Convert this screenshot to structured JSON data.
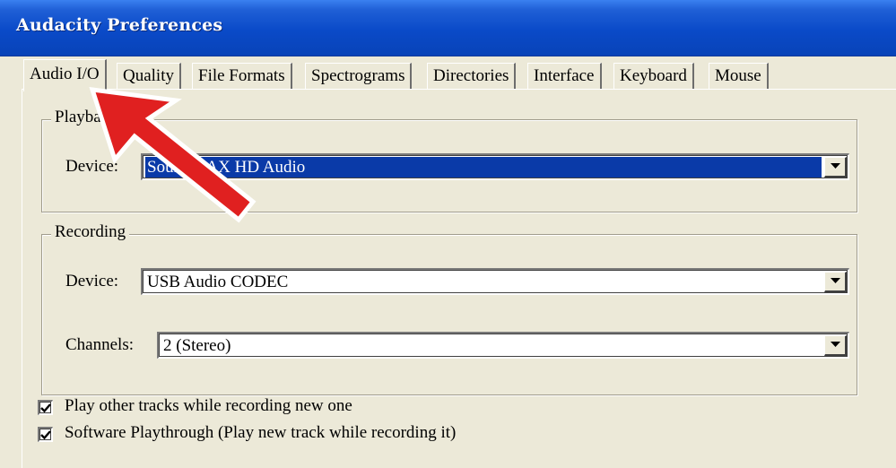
{
  "window": {
    "title": "Audacity Preferences"
  },
  "tabs": [
    {
      "label": "Audio I/O",
      "active": true
    },
    {
      "label": "Quality",
      "active": false
    },
    {
      "label": "File Formats",
      "active": false
    },
    {
      "label": "Spectrograms",
      "active": false
    },
    {
      "label": "Directories",
      "active": false
    },
    {
      "label": "Interface",
      "active": false
    },
    {
      "label": "Keyboard",
      "active": false
    },
    {
      "label": "Mouse",
      "active": false
    }
  ],
  "playback": {
    "group_label": "Playback",
    "device_label": "Device:",
    "device_value": "SoundMAX HD Audio"
  },
  "recording": {
    "group_label": "Recording",
    "device_label": "Device:",
    "device_value": "USB Audio CODEC",
    "channels_label": "Channels:",
    "channels_value": "2 (Stereo)"
  },
  "options": {
    "play_other_tracks": {
      "label": "Play other tracks while recording new one",
      "checked": true
    },
    "software_playthrough": {
      "label": "Software Playthrough (Play new track while recording it)",
      "checked": true
    }
  },
  "annotation": {
    "arrow_color": "#e02020",
    "arrow_outline": "#ffffff"
  },
  "colors": {
    "titlebar": "#0a4ac8",
    "selection": "#0a3aa8",
    "dialog_bg": "#ece9d8"
  }
}
